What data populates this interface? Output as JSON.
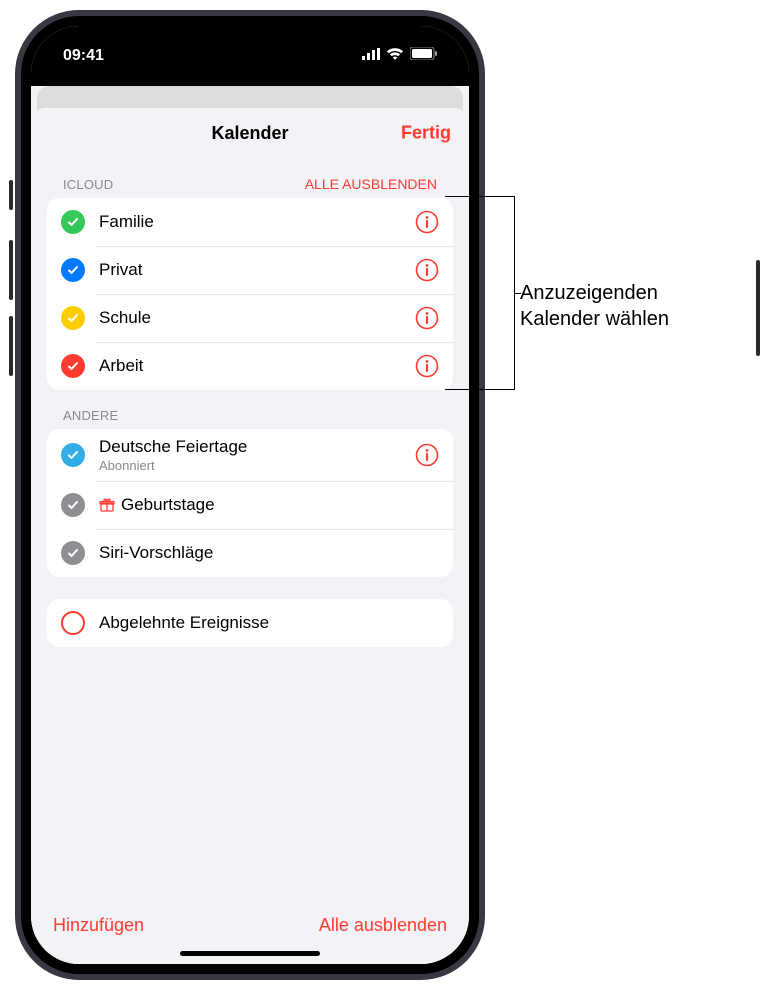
{
  "status": {
    "time": "09:41"
  },
  "sheet": {
    "title": "Kalender",
    "done": "Fertig"
  },
  "sections": {
    "icloud": {
      "title": "ICLOUD",
      "action": "ALLE AUSBLENDEN",
      "items": [
        {
          "label": "Familie",
          "color": "#34c759",
          "checked": true,
          "info": true
        },
        {
          "label": "Privat",
          "color": "#007aff",
          "checked": true,
          "info": true
        },
        {
          "label": "Schule",
          "color": "#ffcc00",
          "checked": true,
          "info": true
        },
        {
          "label": "Arbeit",
          "color": "#ff3b30",
          "checked": true,
          "info": true
        }
      ]
    },
    "andere": {
      "title": "ANDERE",
      "items": [
        {
          "label": "Deutsche Feiertage",
          "sub": "Abonniert",
          "color": "#32ade6",
          "checked": true,
          "info": true
        },
        {
          "label": "Geburtstage",
          "color": "#8e8e93",
          "checked": true,
          "gift": true
        },
        {
          "label": "Siri-Vorschläge",
          "color": "#8e8e93",
          "checked": true
        }
      ]
    },
    "declined": {
      "label": "Abgelehnte Ereignisse",
      "checked": false
    }
  },
  "toolbar": {
    "add": "Hinzufügen",
    "hide_all": "Alle ausblenden"
  },
  "callout": {
    "line1": "Anzuzeigenden",
    "line2": "Kalender wählen"
  },
  "colors": {
    "accent": "#ff3b30"
  }
}
